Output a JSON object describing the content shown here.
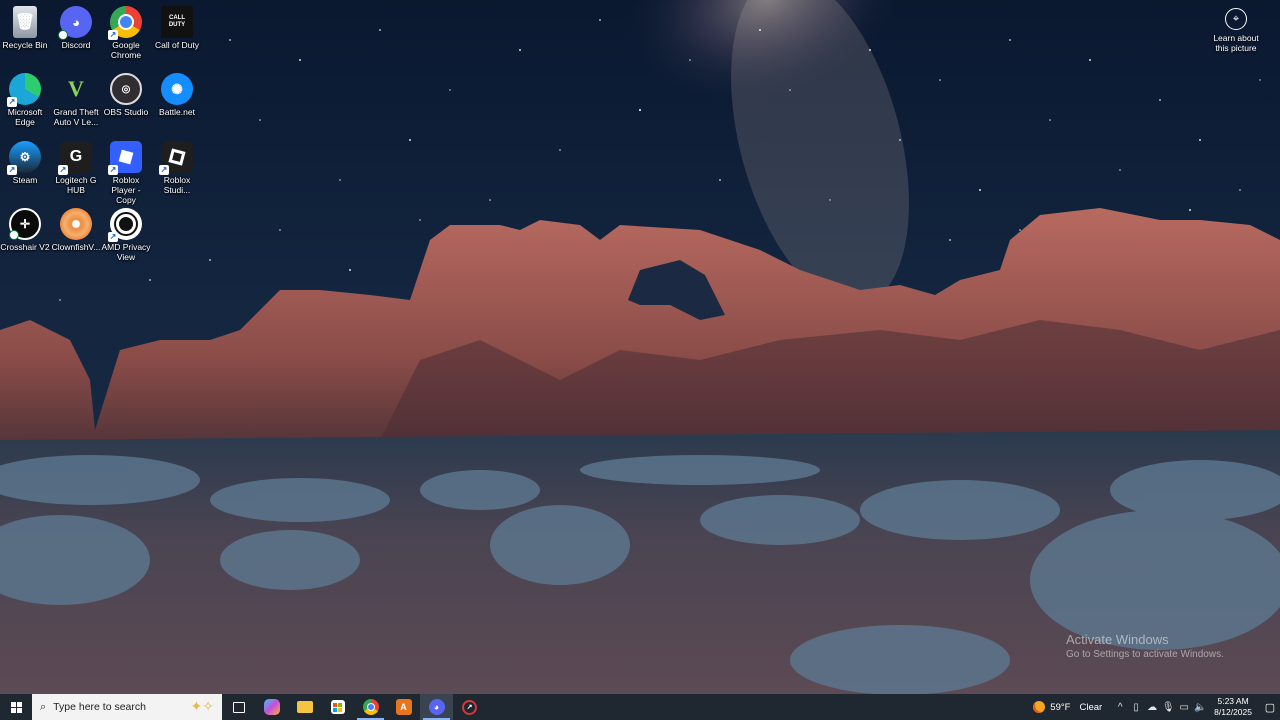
{
  "desktop": {
    "icons": [
      {
        "label": "Recycle Bin",
        "icon": "recycle-bin-icon",
        "color": "#9aa3ad"
      },
      {
        "label": "Discord",
        "icon": "discord-icon",
        "color": "#5865f2"
      },
      {
        "label": "Google Chrome",
        "icon": "chrome-icon",
        "color": "#ea4335"
      },
      {
        "label": "Call of Duty",
        "icon": "call-of-duty-icon",
        "color": "#111111"
      },
      {
        "label": "Microsoft Edge",
        "icon": "edge-icon",
        "color": "#1aa6d6"
      },
      {
        "label": "Grand Theft Auto V Le...",
        "icon": "gta-v-icon",
        "color": "#0d3b1e"
      },
      {
        "label": "OBS Studio",
        "icon": "obs-icon",
        "color": "#302e31"
      },
      {
        "label": "Battle.net",
        "icon": "battlenet-icon",
        "color": "#148eff"
      },
      {
        "label": "Steam",
        "icon": "steam-icon",
        "color": "#1b2838"
      },
      {
        "label": "Logitech G HUB",
        "icon": "logitech-g-icon",
        "color": "#1e1e1e"
      },
      {
        "label": "Roblox Player - Copy",
        "icon": "roblox-player-icon",
        "color": "#335fff"
      },
      {
        "label": "Roblox Studi...",
        "icon": "roblox-studio-icon",
        "color": "#1e1e1e"
      },
      {
        "label": "Crosshair V2",
        "icon": "crosshair-icon",
        "color": "#0b0b0b"
      },
      {
        "label": "ClownfishV...",
        "icon": "clownfish-icon",
        "color": "#f08a3c"
      },
      {
        "label": "AMD Privacy View",
        "icon": "amd-privacy-icon",
        "color": "#ffffff"
      }
    ]
  },
  "learn": {
    "label": "Learn about this picture"
  },
  "activation": {
    "title": "Activate Windows",
    "subtitle": "Go to Settings to activate Windows."
  },
  "taskbar": {
    "search_placeholder": "Type here to search",
    "apps": [
      {
        "name": "task-view",
        "icon": "task-view-icon",
        "color": "#ffffff"
      },
      {
        "name": "copilot",
        "icon": "copilot-icon",
        "color": "#c64fd8"
      },
      {
        "name": "file-explorer",
        "icon": "folder-icon",
        "color": "#f4c542"
      },
      {
        "name": "microsoft-store",
        "icon": "store-icon",
        "color": "#1f7be0"
      },
      {
        "name": "chrome",
        "icon": "chrome-icon",
        "color": "#ea4335"
      },
      {
        "name": "orange-app",
        "icon": "orange-a-icon",
        "color": "#e8761c"
      },
      {
        "name": "discord",
        "icon": "discord-icon",
        "color": "#5865f2"
      },
      {
        "name": "speedometer-app",
        "icon": "speedometer-icon",
        "color": "#d03a3a"
      }
    ],
    "weather": {
      "temp": "59°F",
      "condition": "Clear"
    },
    "time": "5:23 AM",
    "date": "8/12/2025"
  }
}
